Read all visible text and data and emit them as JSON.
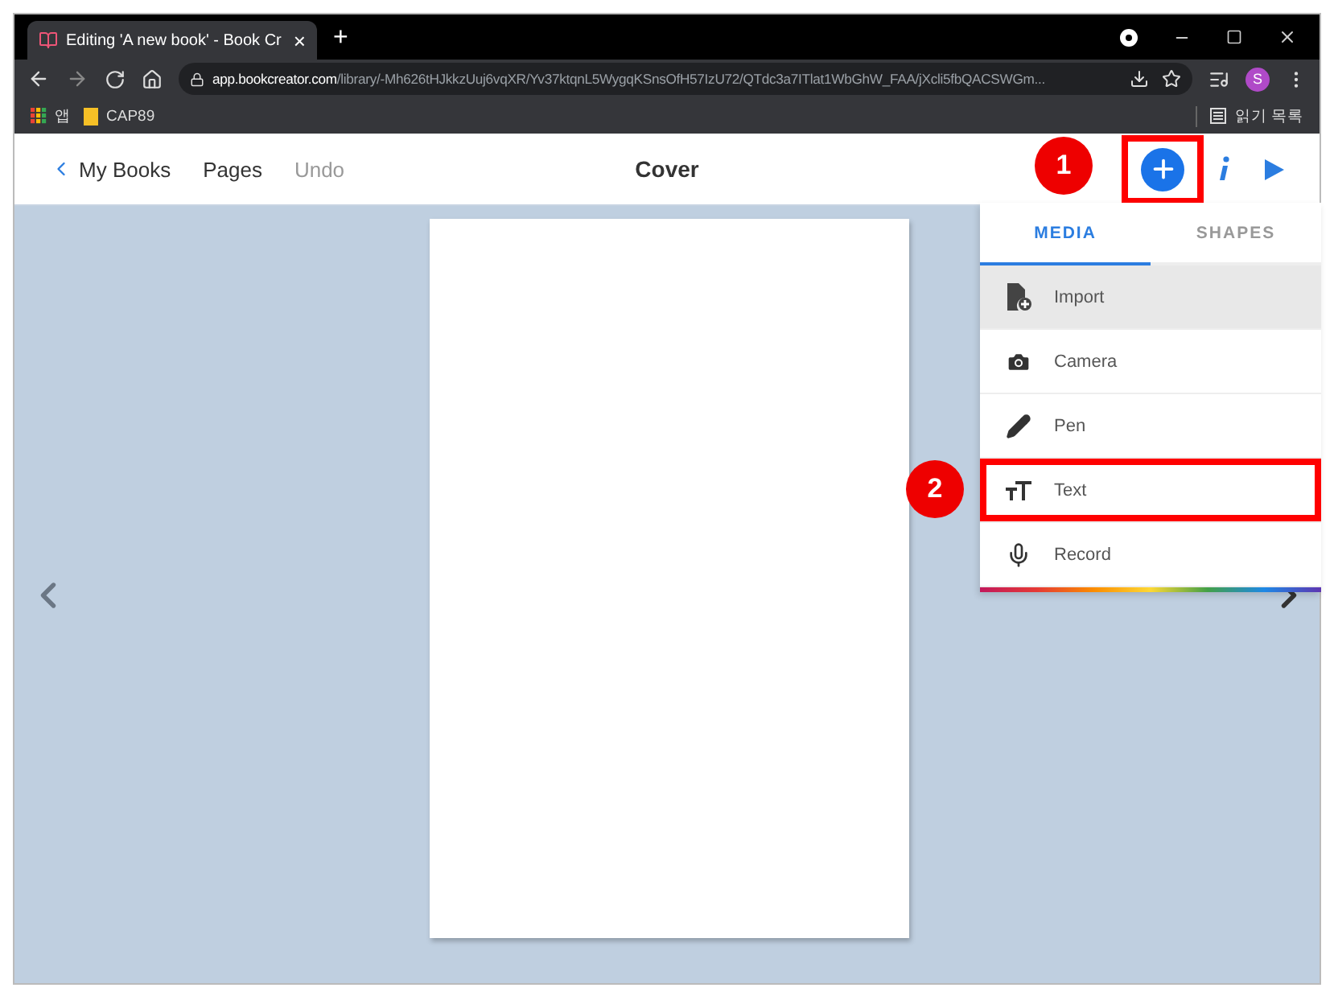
{
  "browser": {
    "tab": {
      "title": "Editing 'A new book' - Book Cr",
      "close": "×"
    },
    "new_tab": "+",
    "address": {
      "domain": "app.bookcreator.com",
      "path": "/library/-Mh626tHJkkzUuj6vqXR/Yv37ktqnL5WygqKSnsOfH57IzU72/QTdc3a7ITlat1WbGhW_FAA/jXcli5fbQACSWGm..."
    },
    "avatar": "S",
    "bookmarks": [
      {
        "label": "앱",
        "kind": "apps"
      },
      {
        "label": "CAP89",
        "kind": "folder"
      }
    ],
    "reading_list": "읽기 목록"
  },
  "toolbar": {
    "back": "My Books",
    "items": [
      {
        "label": "Pages",
        "disabled": false
      },
      {
        "label": "Undo",
        "disabled": true
      }
    ],
    "title": "Cover",
    "add_framed": true
  },
  "menu": {
    "tabs": [
      {
        "label": "MEDIA",
        "selected": true
      },
      {
        "label": "SHAPES",
        "selected": false
      }
    ],
    "items": [
      {
        "label": "Import",
        "kind": "import",
        "highlighted": true,
        "framed": false
      },
      {
        "label": "Camera",
        "kind": "camera",
        "highlighted": false,
        "framed": false
      },
      {
        "label": "Pen",
        "kind": "pen",
        "highlighted": false,
        "framed": false
      },
      {
        "label": "Text",
        "kind": "text",
        "highlighted": false,
        "framed": true
      },
      {
        "label": "Record",
        "kind": "record",
        "highlighted": false,
        "framed": false
      }
    ]
  },
  "annotations": [
    {
      "number": "1"
    },
    {
      "number": "2"
    }
  ]
}
